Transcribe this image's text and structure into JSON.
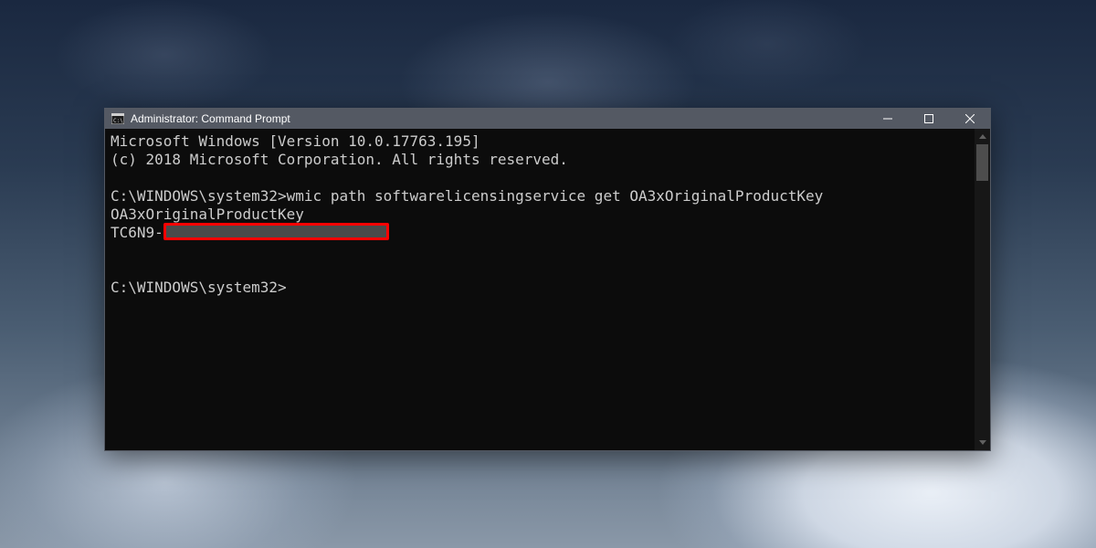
{
  "window": {
    "title": "Administrator: Command Prompt"
  },
  "terminal": {
    "line_version": "Microsoft Windows [Version 10.0.17763.195]",
    "line_copyright": "(c) 2018 Microsoft Corporation. All rights reserved.",
    "prompt1_prefix": "C:\\WINDOWS\\system32>",
    "command1": "wmic path softwarelicensingservice get OA3xOriginalProductKey",
    "output_header": "OA3xOriginalProductKey",
    "output_value_prefix": "TC6N9-",
    "prompt2": "C:\\WINDOWS\\system32>"
  }
}
